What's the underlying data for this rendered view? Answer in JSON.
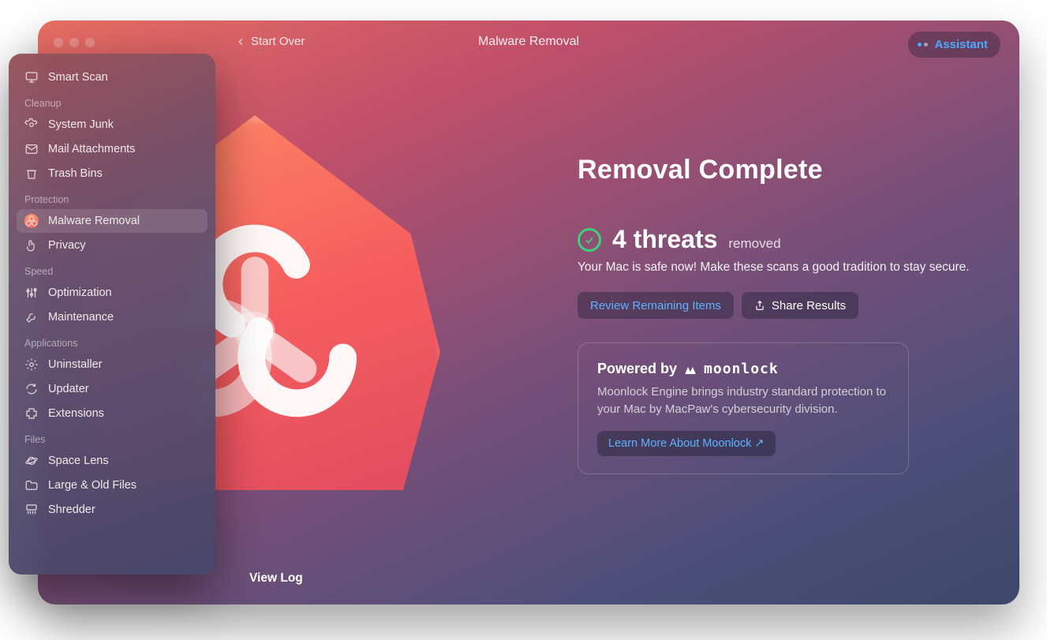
{
  "header": {
    "start_over": "Start Over",
    "title": "Malware Removal",
    "assistant": "Assistant"
  },
  "sidebar": {
    "smart_scan": "Smart Scan",
    "sections": {
      "cleanup": {
        "label": "Cleanup",
        "items": [
          "System Junk",
          "Mail Attachments",
          "Trash Bins"
        ]
      },
      "protection": {
        "label": "Protection",
        "items": [
          "Malware Removal",
          "Privacy"
        ]
      },
      "speed": {
        "label": "Speed",
        "items": [
          "Optimization",
          "Maintenance"
        ]
      },
      "applications": {
        "label": "Applications",
        "items": [
          "Uninstaller",
          "Updater",
          "Extensions"
        ]
      },
      "files": {
        "label": "Files",
        "items": [
          "Space Lens",
          "Large & Old Files",
          "Shredder"
        ]
      }
    }
  },
  "main": {
    "heading": "Removal Complete",
    "threat_count": "4 threats",
    "threat_suffix": "removed",
    "safe_line": "Your Mac is safe now! Make these scans a good tradition to stay secure.",
    "review_btn": "Review Remaining Items",
    "share_btn": "Share Results",
    "moonlock": {
      "prefix": "Powered by",
      "brand": "moonlock",
      "desc": "Moonlock Engine brings industry standard protection to your Mac by MacPaw's cybersecurity division.",
      "learn_more": "Learn More About Moonlock ↗"
    },
    "view_log": "View Log"
  }
}
